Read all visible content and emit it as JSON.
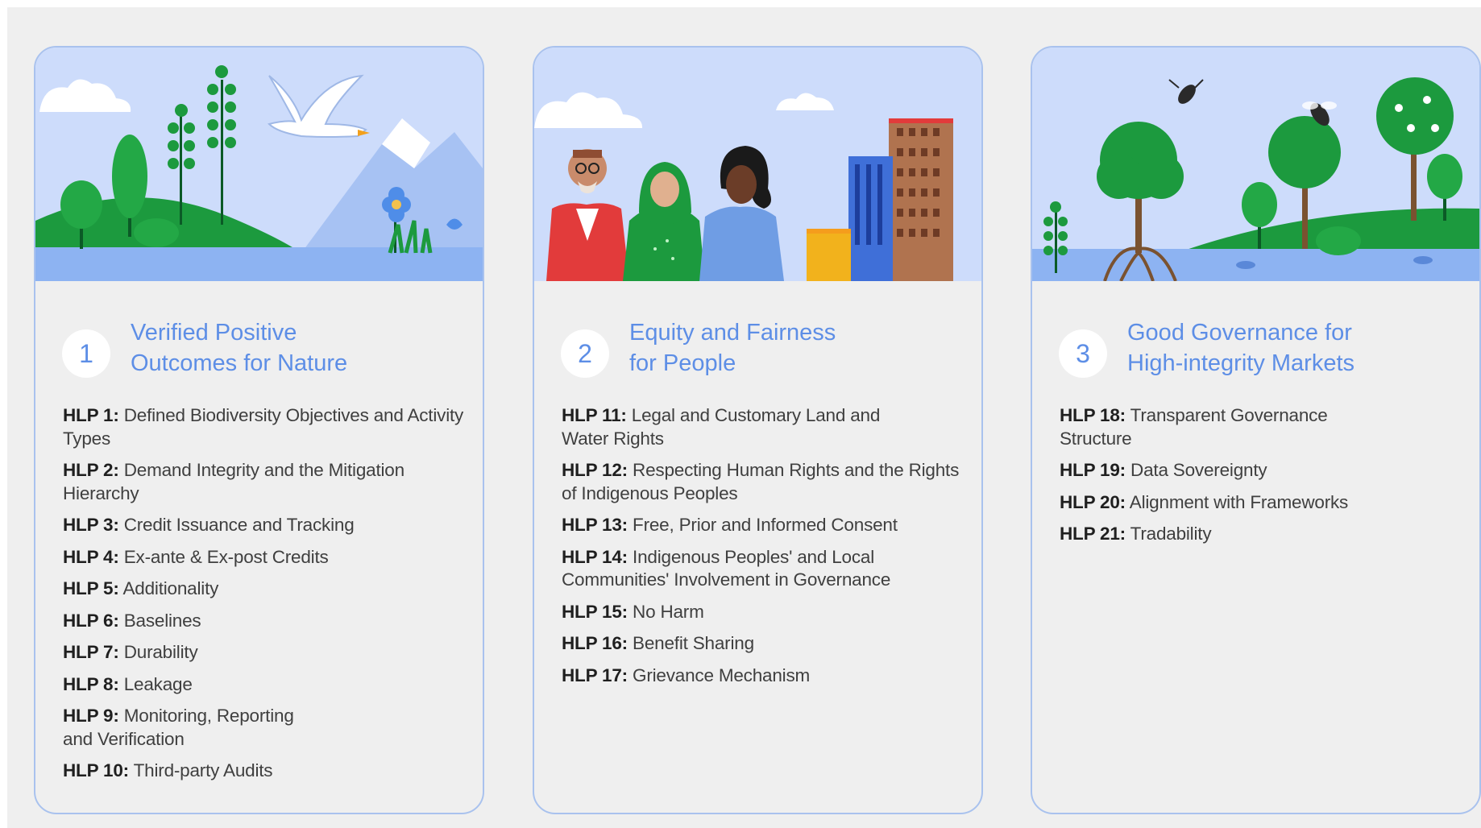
{
  "pillars": [
    {
      "number": "1",
      "title_line1": "Verified Positive",
      "title_line2": "Outcomes for Nature",
      "items": [
        {
          "code": "HLP 1:",
          "text": "Defined Biodiversity Objectives and Activity Types"
        },
        {
          "code": "HLP 2:",
          "text": "Demand Integrity and the Mitigation Hierarchy"
        },
        {
          "code": "HLP 3:",
          "text": "Credit Issuance and Tracking"
        },
        {
          "code": "HLP 4:",
          "text": "Ex-ante & Ex-post Credits"
        },
        {
          "code": "HLP 5:",
          "text": "Additionality"
        },
        {
          "code": "HLP 6:",
          "text": "Baselines"
        },
        {
          "code": "HLP 7:",
          "text": "Durability"
        },
        {
          "code": "HLP 8:",
          "text": "Leakage"
        },
        {
          "code": "HLP 9:",
          "text": "Monitoring, Reporting and Verification"
        },
        {
          "code": "HLP 10:",
          "text": "Third-party Audits"
        }
      ]
    },
    {
      "number": "2",
      "title_line1": "Equity and Fairness",
      "title_line2": "for People",
      "items": [
        {
          "code": "HLP 11:",
          "text": "Legal and Customary Land and Water Rights"
        },
        {
          "code": "HLP 12:",
          "text": "Respecting Human Rights and the Rights of Indigenous Peoples"
        },
        {
          "code": "HLP 13:",
          "text": "Free, Prior and Informed Consent"
        },
        {
          "code": "HLP 14:",
          "text": "Indigenous Peoples' and Local Communities' Involvement in Governance"
        },
        {
          "code": "HLP 15:",
          "text": "No Harm"
        },
        {
          "code": "HLP 16:",
          "text": "Benefit Sharing"
        },
        {
          "code": "HLP 17:",
          "text": "Grievance Mechanism"
        }
      ]
    },
    {
      "number": "3",
      "title_line1": "Good Governance for",
      "title_line2": "High-integrity Markets",
      "items": [
        {
          "code": "HLP 18:",
          "text": "Transparent Governance Structure"
        },
        {
          "code": "HLP 19:",
          "text": "Data Sovereignty"
        },
        {
          "code": "HLP 20:",
          "text": "Alignment with Frameworks"
        },
        {
          "code": "HLP 21:",
          "text": "Tradability"
        }
      ]
    }
  ],
  "colors": {
    "card_border": "#a9c2ee",
    "sky": "#cddcfb",
    "water": "#8db3f2",
    "green": "#1c9a3e",
    "title_blue": "#5d8ee6"
  }
}
